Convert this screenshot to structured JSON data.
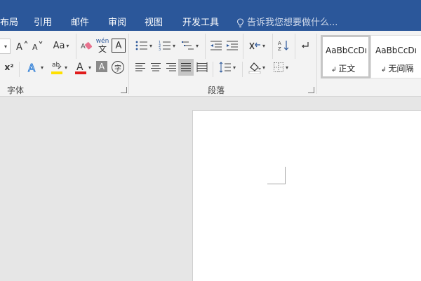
{
  "colors": {
    "accent": "#2b579a",
    "font_color_red": "#e01b1b",
    "highlight_yellow": "#ffe000"
  },
  "tabs": [
    "布局",
    "引用",
    "邮件",
    "审阅",
    "视图",
    "开发工具"
  ],
  "tell_me": {
    "placeholder": "告诉我您想要做什么..."
  },
  "font_group": {
    "label": "字体",
    "case_button": "Aa",
    "superscript": "x²",
    "pinyin_top": "wén",
    "pinyin_bottom": "文",
    "char_border": "A",
    "char_shading": "A",
    "enclose_char": "字"
  },
  "paragraph_group": {
    "label": "段落"
  },
  "styles": [
    {
      "sample": "AaBbCcDı",
      "name": "正文"
    },
    {
      "sample": "AaBbCcDı",
      "name": "无间隔"
    }
  ]
}
